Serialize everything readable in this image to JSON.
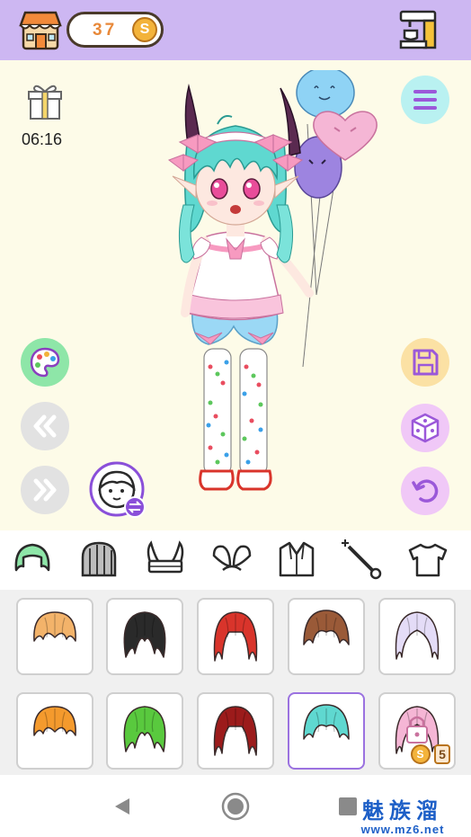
{
  "top_bar": {
    "shop_icon": "shop-icon",
    "coins": "37",
    "coin_symbol": "S",
    "machine_icon": "coffee-machine-icon"
  },
  "stage": {
    "gift_icon": "gift-icon",
    "timer": "06:16",
    "buttons": {
      "menu": "menu-icon",
      "palette": "palette-icon",
      "previous": "rewind-icon",
      "next": "fast-forward-icon",
      "face_swap": "face-swap-icon",
      "save": "save-icon",
      "random": "dice-icon",
      "undo": "undo-icon"
    }
  },
  "categories": [
    {
      "name": "hair",
      "selected": true
    },
    {
      "name": "hood"
    },
    {
      "name": "horns"
    },
    {
      "name": "ears"
    },
    {
      "name": "jacket"
    },
    {
      "name": "wand"
    },
    {
      "name": "shirt"
    }
  ],
  "hair_items": [
    {
      "color": "#f3b36a"
    },
    {
      "color": "#2a2a2a"
    },
    {
      "color": "#d9342b"
    },
    {
      "color": "#9a5a38"
    },
    {
      "color": "#e4dcf7"
    },
    {
      "color": "#f49a2d"
    },
    {
      "color": "#59c93e"
    },
    {
      "color": "#9c1b1b"
    },
    {
      "color": "#5fd8d0",
      "selected": true
    },
    {
      "color": "#f5b6d5",
      "locked": true,
      "price": "5",
      "coin_symbol": "S"
    }
  ],
  "navigation": {
    "back": "back-triangle-icon",
    "home": "home-circle-icon",
    "recents": "recents-square-icon"
  },
  "watermark": {
    "title": "魅族溜",
    "url": "www.mz6.net"
  },
  "colors": {
    "top_bar": "#cdb7f2",
    "stage_bg": "#fdfbe8",
    "accent": "#9b72e0",
    "coin": "#f3b33b"
  }
}
